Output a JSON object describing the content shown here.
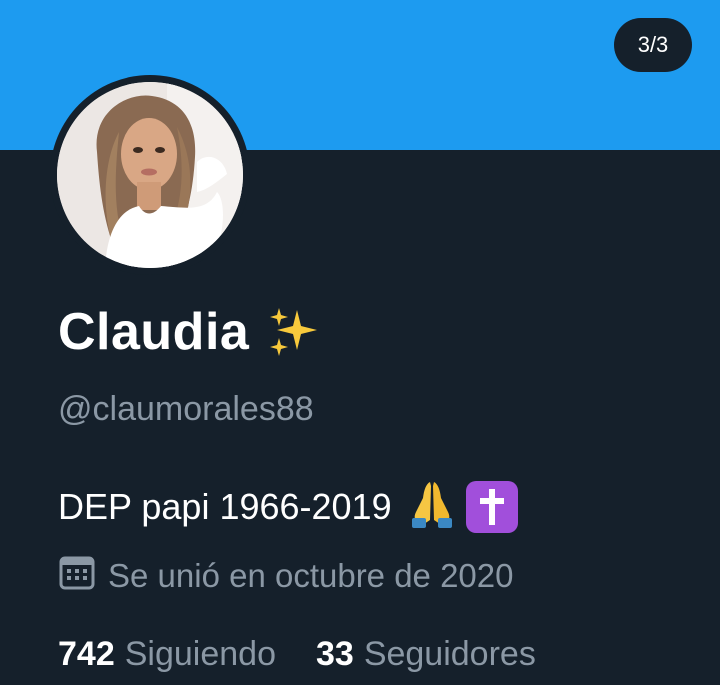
{
  "header": {
    "image_counter": "3/3",
    "banner_color": "#1d9bf0"
  },
  "profile": {
    "display_name": "Claudia",
    "name_emoji": "sparkles-icon",
    "handle": "@claumorales88",
    "bio_text": "DEP papi 1966-2019",
    "bio_emojis": [
      "folded-hands-icon",
      "latin-cross-icon"
    ],
    "joined": "Se unió en octubre de 2020",
    "following_count": "742",
    "following_label": "Siguiendo",
    "followers_count": "33",
    "followers_label": "Seguidores"
  },
  "colors": {
    "background": "#15202b",
    "text_primary": "#ffffff",
    "text_secondary": "#8b98a5",
    "cross_badge": "#a14fdb"
  }
}
